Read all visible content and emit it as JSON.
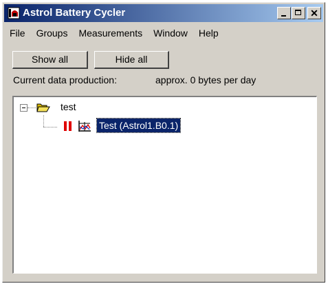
{
  "window": {
    "title": "Astrol Battery Cycler",
    "icon": "battery-app-icon"
  },
  "titlebar": {
    "minimize_icon": "minimize-icon",
    "maximize_icon": "maximize-icon",
    "close_icon": "close-icon",
    "close_glyph": "✕"
  },
  "menu": {
    "items": [
      "File",
      "Groups",
      "Measurements",
      "Window",
      "Help"
    ]
  },
  "toolbar": {
    "show_all": "Show all",
    "hide_all": "Hide all"
  },
  "status": {
    "label": "Current data production:",
    "value": "approx. 0  bytes per day"
  },
  "tree": {
    "root": {
      "label": "test",
      "icon": "open-folder-icon",
      "expanded": true,
      "children": [
        {
          "label": "Test (Astrol1.B0.1)",
          "state_icon": "pause-icon",
          "type_icon": "chart-icon",
          "selected": true
        }
      ]
    }
  },
  "colors": {
    "titlebar_start": "#0a246a",
    "titlebar_end": "#a6caf0",
    "selection": "#0a246a",
    "window_face": "#d4d0c8",
    "pause": "#e00000",
    "folder": "#f5e15a"
  }
}
